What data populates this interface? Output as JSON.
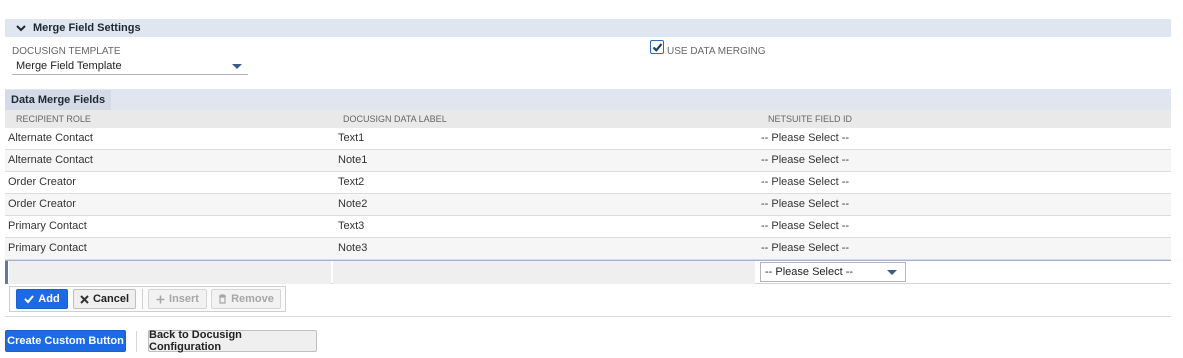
{
  "section": {
    "title": "Merge Field Settings"
  },
  "template": {
    "label": "DOCUSIGN TEMPLATE",
    "value": "Merge Field Template"
  },
  "data_merging": {
    "label": "USE DATA MERGING",
    "checked": true
  },
  "subtab": {
    "label": "Data Merge Fields"
  },
  "columns": {
    "recipient_role": "RECIPIENT ROLE",
    "data_label": "DOCUSIGN DATA LABEL",
    "field_id": "NETSUITE FIELD ID"
  },
  "rows": [
    {
      "role": "Alternate Contact",
      "label": "Text1",
      "field": "-- Please Select --"
    },
    {
      "role": "Alternate Contact",
      "label": "Note1",
      "field": "-- Please Select --"
    },
    {
      "role": "Order Creator",
      "label": "Text2",
      "field": "-- Please Select --"
    },
    {
      "role": "Order Creator",
      "label": "Note2",
      "field": "-- Please Select --"
    },
    {
      "role": "Primary Contact",
      "label": "Text3",
      "field": "-- Please Select --"
    },
    {
      "role": "Primary Contact",
      "label": "Note3",
      "field": "-- Please Select --"
    }
  ],
  "edit_row": {
    "field_value": "-- Please Select --"
  },
  "buttons": {
    "add": "Add",
    "cancel": "Cancel",
    "insert": "Insert",
    "remove": "Remove"
  },
  "actions": {
    "create_button": "Create Custom Button",
    "back_button": "Back to Docusign Configuration"
  },
  "colors": {
    "accent": "#1d6ae5",
    "header_bg": "#e0e6ef"
  }
}
